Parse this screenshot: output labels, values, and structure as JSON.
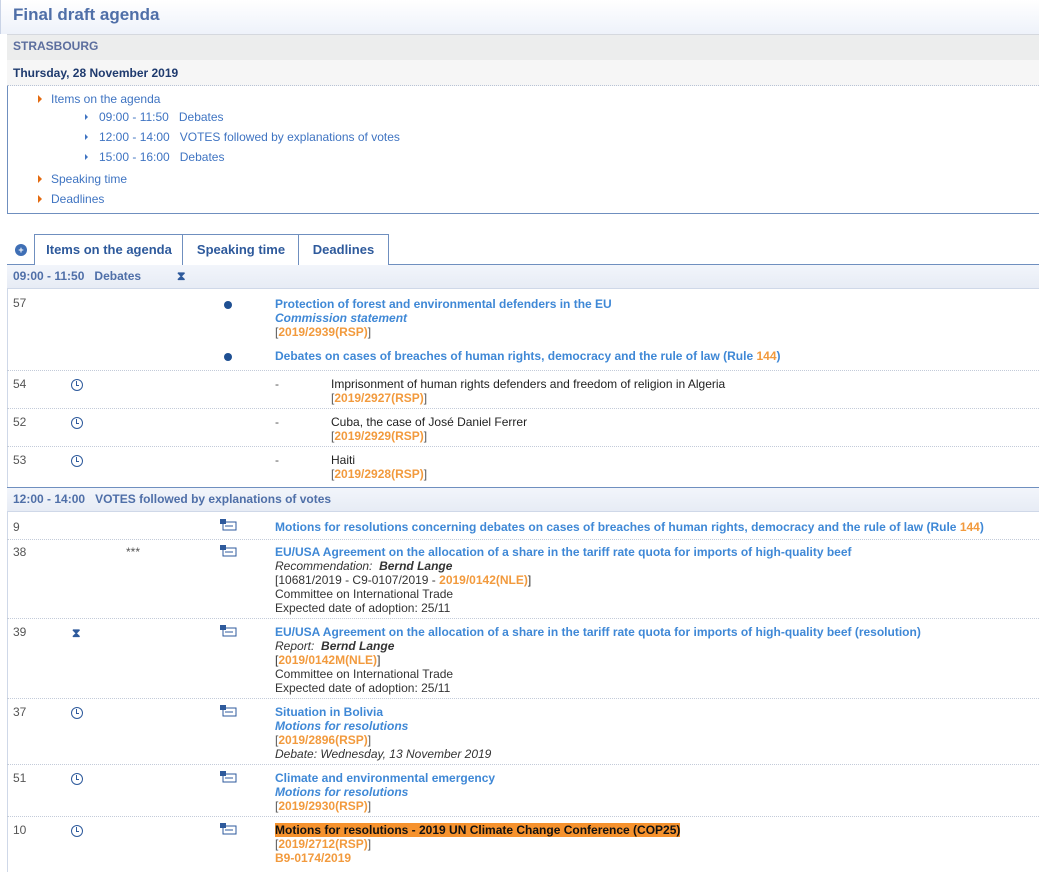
{
  "page_title": "Final draft agenda",
  "city": "STRASBOURG",
  "date": "Thursday, 28 November 2019",
  "toc": {
    "items_label": "Items on the agenda",
    "sub": [
      {
        "time": "09:00 - 11:50",
        "label": "Debates"
      },
      {
        "time": "12:00 - 14:00",
        "label": "VOTES followed by explanations of votes"
      },
      {
        "time": "15:00 - 16:00",
        "label": "Debates"
      }
    ],
    "speaking_time": "Speaking time",
    "deadlines": "Deadlines"
  },
  "tabs": [
    "Items on the agenda",
    "Speaking time",
    "Deadlines"
  ],
  "sections": {
    "debates": {
      "time": "09:00 - 11:50",
      "label": "Debates"
    },
    "votes": {
      "time": "12:00 - 14:00",
      "label": "VOTES followed by explanations of votes"
    }
  },
  "debate_items": [
    {
      "num": "57",
      "title": "Protection of forest and environmental defenders in the EU",
      "sub": "Commission statement",
      "ref": "2019/2939(RSP)"
    },
    {
      "num": "",
      "title": "Debates on cases of breaches of human rights, democracy and the rule of law (Rule",
      "rule": "144",
      "close": ")"
    },
    {
      "num": "54",
      "dash": "-",
      "title": "Imprisonment of human rights defenders and freedom of religion in Algeria",
      "ref": "2019/2927(RSP)"
    },
    {
      "num": "52",
      "dash": "-",
      "title": "Cuba, the case of José Daniel Ferrer",
      "ref": "2019/2929(RSP)"
    },
    {
      "num": "53",
      "dash": "-",
      "title": "Haiti",
      "ref": "2019/2928(RSP)"
    }
  ],
  "vote_items": [
    {
      "num": "9",
      "title": "Motions for resolutions concerning debates on cases of breaches of human rights, democracy and the rule of law (Rule",
      "rule": "144",
      "close": ")"
    },
    {
      "num": "38",
      "stars": "***",
      "title": "EU/USA Agreement on the allocation of a share in the tariff rate quota for imports of high-quality beef",
      "role": "Recommendation:",
      "person": "Bernd Lange",
      "ref_prefix": "10681/2019 - C9-0107/2019 - ",
      "ref": "2019/0142(NLE)",
      "committee": "Committee on International Trade",
      "adoption": "Expected date of adoption: 25/11"
    },
    {
      "num": "39",
      "title": "EU/USA Agreement on the allocation of a share in the tariff rate quota for imports of high-quality beef (resolution)",
      "role": "Report:",
      "person": "Bernd Lange",
      "ref": "2019/0142M(NLE)",
      "committee": "Committee on International Trade",
      "adoption": "Expected date of adoption: 25/11"
    },
    {
      "num": "37",
      "title": "Situation in Bolivia",
      "sub": "Motions for resolutions",
      "ref": "2019/2896(RSP)",
      "debate": "Debate: Wednesday, 13 November 2019"
    },
    {
      "num": "51",
      "title": "Climate and environmental emergency",
      "sub": "Motions for resolutions",
      "ref": "2019/2930(RSP)"
    },
    {
      "num": "10",
      "title": "Motions for resolutions - 2019 UN Climate Change Conference (COP25)",
      "ref": "2019/2712(RSP)",
      "doc": "B9-0174/2019"
    }
  ],
  "colors": {
    "accent": "#3f88d6",
    "orange": "#f29a3d",
    "highlight": "#f6922d",
    "header": "#4f6fa8"
  }
}
